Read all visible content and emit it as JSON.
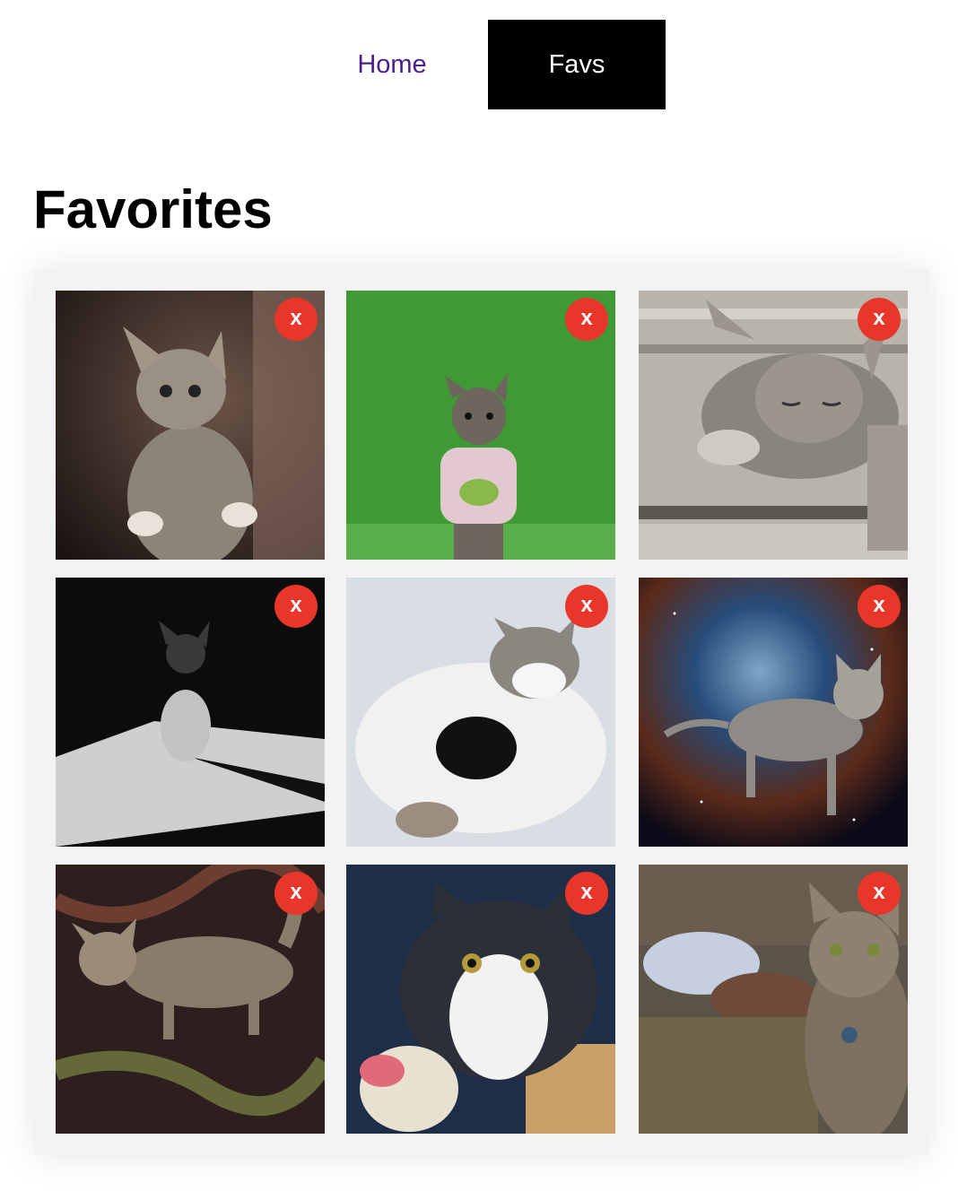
{
  "nav": {
    "items": [
      {
        "label": "Home",
        "active": false
      },
      {
        "label": "Favs",
        "active": true
      }
    ]
  },
  "page": {
    "title": "Favorites"
  },
  "favorites": [
    {
      "remove_label": "x"
    },
    {
      "remove_label": "x"
    },
    {
      "remove_label": "x"
    },
    {
      "remove_label": "x"
    },
    {
      "remove_label": "x"
    },
    {
      "remove_label": "x"
    },
    {
      "remove_label": "x"
    },
    {
      "remove_label": "x"
    },
    {
      "remove_label": "x"
    }
  ],
  "colors": {
    "link": "#4b1f8c",
    "active_tab_bg": "#000000",
    "active_tab_text": "#ffffff",
    "remove_button": "#e8372a"
  }
}
